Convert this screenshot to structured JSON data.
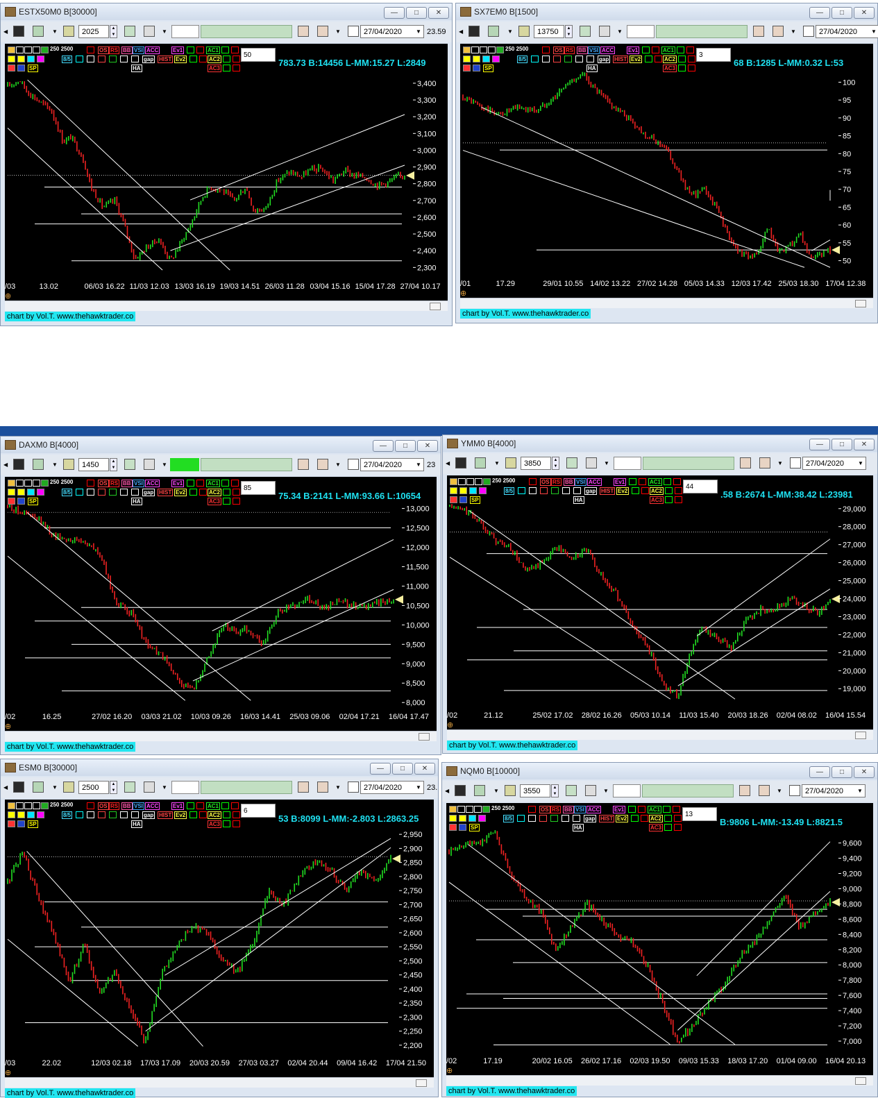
{
  "credit": "chart by Vol.T. www.thehawktrader.co",
  "toolbar_common": {
    "periods": "250 2500",
    "ha": "HA",
    "gap": "gap",
    "hist": "HIST",
    "sp": "SP",
    "ev1": "Ev1",
    "ev2": "Ev2",
    "ac1": "AC1",
    "ac2": "AC2",
    "ac3": "AC3",
    "os": "OS",
    "rs": "RS",
    "bb": "BB",
    "vsi": "VSI",
    "acc": "ACC",
    "ratio": "8/5"
  },
  "windows": [
    {
      "title": "ESTX50M0 B[30000]",
      "interval": "2025",
      "date": "27/04/2020",
      "trail": "23.59",
      "ov_value": "50",
      "readout": "783.73 B:14456 L-MM:15.27 L:2849",
      "chart_data": {
        "type": "line",
        "title": "ESTX50M0 B[30000]",
        "yticks": [
          "3,400",
          "3,300",
          "3,200",
          "3,100",
          "3,000",
          "2,900",
          "2,800",
          "2,700",
          "2,600",
          "2,500",
          "2,400",
          "2,300"
        ],
        "ylim": [
          2260,
          3470
        ],
        "xticks": [
          "/03",
          "13.02",
          "06/03 16.22",
          "11/03 12.03",
          "13/03 16.19",
          "19/03 14.51",
          "26/03 11.28",
          "03/04 15.16",
          "15/04 17.28",
          "27/04 10.17"
        ],
        "x": [
          0,
          0.03,
          0.05,
          0.08,
          0.11,
          0.14,
          0.16,
          0.19,
          0.21,
          0.24,
          0.27,
          0.29,
          0.32,
          0.35,
          0.38,
          0.41,
          0.43,
          0.46,
          0.49,
          0.51,
          0.54,
          0.57,
          0.6,
          0.62,
          0.65,
          0.68,
          0.71,
          0.74,
          0.76,
          0.79,
          0.82,
          0.85,
          0.87,
          0.9,
          0.93,
          0.96,
          0.98,
          1.0
        ],
        "y": [
          3380,
          3420,
          3350,
          3290,
          3240,
          3050,
          3080,
          2950,
          2780,
          2660,
          2700,
          2580,
          2350,
          2420,
          2470,
          2340,
          2420,
          2550,
          2720,
          2780,
          2760,
          2700,
          2780,
          2640,
          2650,
          2820,
          2870,
          2840,
          2880,
          2890,
          2820,
          2880,
          2850,
          2840,
          2790,
          2810,
          2840,
          2850
        ],
        "hlines": [
          2850,
          2780,
          2620,
          2560,
          2340
        ],
        "last": 2849
      }
    },
    {
      "title": "SX7EM0 B[1500]",
      "interval": "13750",
      "date": "27/04/2020",
      "trail": "",
      "ov_value": "3",
      "readout": "68 B:1285 L-MM:0.32 L:53",
      "chart_data": {
        "type": "line",
        "title": "SX7EM0 B[1500]",
        "yticks": [
          "100",
          "95",
          "90",
          "85",
          "80",
          "75",
          "70",
          "65",
          "60",
          "55",
          "50"
        ],
        "ylim": [
          47,
          103
        ],
        "xticks": [
          "/01",
          "17.29",
          "29/01 10.55",
          "14/02 13.22",
          "27/02 14.28",
          "05/03 14.33",
          "12/03 17.42",
          "25/03 18.30",
          "17/04 12.38"
        ],
        "x": [
          0,
          0.05,
          0.1,
          0.15,
          0.2,
          0.25,
          0.3,
          0.33,
          0.36,
          0.4,
          0.45,
          0.5,
          0.55,
          0.58,
          0.62,
          0.66,
          0.7,
          0.73,
          0.76,
          0.8,
          0.83,
          0.86,
          0.89,
          0.92,
          0.95,
          0.98,
          1.0
        ],
        "y": [
          96,
          93,
          91,
          93,
          92,
          96,
          101,
          102,
          98,
          94,
          90,
          85,
          82,
          76,
          68,
          70,
          63,
          55,
          52,
          51,
          59,
          52,
          54,
          57,
          50,
          52,
          53
        ],
        "hlines": [
          83,
          81,
          53
        ],
        "last": 53
      }
    },
    {
      "title": "DAXM0 B[4000]",
      "interval": "1450",
      "date": "27/04/2020",
      "trail": "23",
      "ov_value": "85",
      "readout": "75.34 B:2141 L-MM:93.66 L:10654",
      "chart_data": {
        "type": "line",
        "title": "DAXM0 B[4000]",
        "yticks": [
          "13,000",
          "12,500",
          "12,000",
          "11,500",
          "11,000",
          "10,500",
          "10,000",
          "9,500",
          "9,000",
          "8,500",
          "8,000"
        ],
        "ylim": [
          7950,
          13100
        ],
        "xticks": [
          "/02",
          "16.25",
          "27/02 16.20",
          "03/03 21.02",
          "10/03 09.26",
          "16/03 14.41",
          "25/03 09.06",
          "02/04 17.21",
          "16/04 17.47"
        ],
        "x": [
          0,
          0.04,
          0.08,
          0.12,
          0.16,
          0.2,
          0.24,
          0.28,
          0.32,
          0.36,
          0.4,
          0.44,
          0.48,
          0.52,
          0.56,
          0.59,
          0.62,
          0.66,
          0.7,
          0.74,
          0.78,
          0.82,
          0.86,
          0.9,
          0.94,
          0.97,
          1.0
        ],
        "y": [
          13050,
          12900,
          12700,
          12300,
          12200,
          12150,
          11800,
          10600,
          10300,
          9500,
          9200,
          8600,
          8300,
          9200,
          10000,
          9800,
          9900,
          9500,
          10300,
          10500,
          10700,
          10400,
          10600,
          10500,
          10500,
          10600,
          10654
        ],
        "hlines": [
          12900,
          12500,
          10450,
          10100,
          9500,
          9150,
          8300
        ],
        "last": 10654
      }
    },
    {
      "title": "YMM0 B[4000]",
      "interval": "3850",
      "date": "27/04/2020",
      "trail": "",
      "ov_value": "44",
      "readout": ".58 B:2674 L-MM:38.42 L:23981",
      "chart_data": {
        "type": "line",
        "title": "YMM0 B[4000]",
        "yticks": [
          "29,000",
          "28,000",
          "27,000",
          "26,000",
          "25,000",
          "24,000",
          "23,000",
          "22,000",
          "21,000",
          "20,000",
          "19,000"
        ],
        "ylim": [
          18200,
          29300
        ],
        "xticks": [
          "/02",
          "21.12",
          "25/02 17.02",
          "28/02 16.26",
          "05/03 10.14",
          "11/03 15.40",
          "20/03 18.26",
          "02/04 08.02",
          "16/04 15.54"
        ],
        "x": [
          0,
          0.04,
          0.08,
          0.12,
          0.16,
          0.2,
          0.24,
          0.28,
          0.32,
          0.36,
          0.4,
          0.44,
          0.48,
          0.52,
          0.56,
          0.6,
          0.63,
          0.66,
          0.7,
          0.74,
          0.78,
          0.82,
          0.86,
          0.9,
          0.94,
          0.97,
          1.0
        ],
        "y": [
          29100,
          28900,
          28300,
          27200,
          26800,
          25500,
          25900,
          26900,
          26200,
          26700,
          25200,
          24200,
          22500,
          21300,
          19300,
          18600,
          20900,
          22300,
          21800,
          21300,
          22800,
          23400,
          23500,
          24000,
          23500,
          23200,
          23981
        ],
        "hlines": [
          27700,
          26500,
          23400,
          22400,
          21100,
          20600,
          18900
        ],
        "last": 23981
      }
    },
    {
      "title": "ESM0 B[30000]",
      "interval": "2500",
      "date": "27/04/2020",
      "trail": "23.",
      "ov_value": "6",
      "readout": "53 B:8099 L-MM:-2.803 L:2863.25",
      "chart_data": {
        "type": "line",
        "title": "ESM0 B[30000]",
        "yticks": [
          "2,950",
          "2,900",
          "2,850",
          "2,800",
          "2,750",
          "2,700",
          "2,650",
          "2,600",
          "2,550",
          "2,500",
          "2,450",
          "2,400",
          "2,350",
          "2,300",
          "2,250",
          "2,200"
        ],
        "ylim": [
          2180,
          2975
        ],
        "xticks": [
          "/03",
          "22.02",
          "12/03 02.18",
          "17/03 17.09",
          "20/03 20.59",
          "27/03 03.27",
          "02/04 20.44",
          "09/04 16.42",
          "17/04 21.50"
        ],
        "x": [
          0,
          0.04,
          0.08,
          0.12,
          0.16,
          0.2,
          0.24,
          0.28,
          0.32,
          0.36,
          0.4,
          0.44,
          0.48,
          0.52,
          0.56,
          0.6,
          0.64,
          0.68,
          0.72,
          0.76,
          0.8,
          0.84,
          0.88,
          0.92,
          0.96,
          1.0
        ],
        "y": [
          2780,
          2890,
          2720,
          2600,
          2420,
          2560,
          2380,
          2460,
          2320,
          2210,
          2450,
          2550,
          2620,
          2600,
          2500,
          2460,
          2560,
          2750,
          2700,
          2800,
          2850,
          2830,
          2750,
          2820,
          2780,
          2863
        ],
        "hlines": [
          2870,
          2710,
          2620,
          2550,
          2430,
          2280
        ],
        "last": 2863.25
      }
    },
    {
      "title": "NQM0 B[10000]",
      "interval": "3550",
      "date": "27/04/2020",
      "trail": "",
      "ov_value": "13",
      "readout": "B:9806 L-MM:-13.49 L:8821.5",
      "chart_data": {
        "type": "line",
        "title": "NQM0 B[10000]",
        "yticks": [
          "9,600",
          "9,400",
          "9,200",
          "9,000",
          "8,800",
          "8,600",
          "8,400",
          "8,200",
          "8,000",
          "7,800",
          "7,600",
          "7,400",
          "7,200",
          "7,000"
        ],
        "ylim": [
          6900,
          9760
        ],
        "xticks": [
          "/02",
          "17.19",
          "20/02 16.05",
          "26/02 17.16",
          "02/03 19.50",
          "09/03 15.33",
          "18/03 17.20",
          "01/04 09.00",
          "16/04 20.13"
        ],
        "x": [
          0,
          0.04,
          0.08,
          0.12,
          0.16,
          0.2,
          0.24,
          0.28,
          0.32,
          0.36,
          0.4,
          0.44,
          0.48,
          0.52,
          0.56,
          0.6,
          0.64,
          0.68,
          0.72,
          0.76,
          0.8,
          0.84,
          0.88,
          0.92,
          0.96,
          1.0
        ],
        "y": [
          9500,
          9580,
          9600,
          9750,
          9200,
          8900,
          8700,
          8200,
          8500,
          8800,
          8600,
          8400,
          8300,
          8000,
          7500,
          7000,
          7200,
          7500,
          7700,
          8100,
          8300,
          8600,
          8900,
          8500,
          8700,
          8821
        ],
        "hlines": [
          8840,
          8730,
          8640,
          8330,
          8030,
          7620,
          7560,
          7430,
          6950
        ],
        "last": 8821.5
      }
    }
  ]
}
